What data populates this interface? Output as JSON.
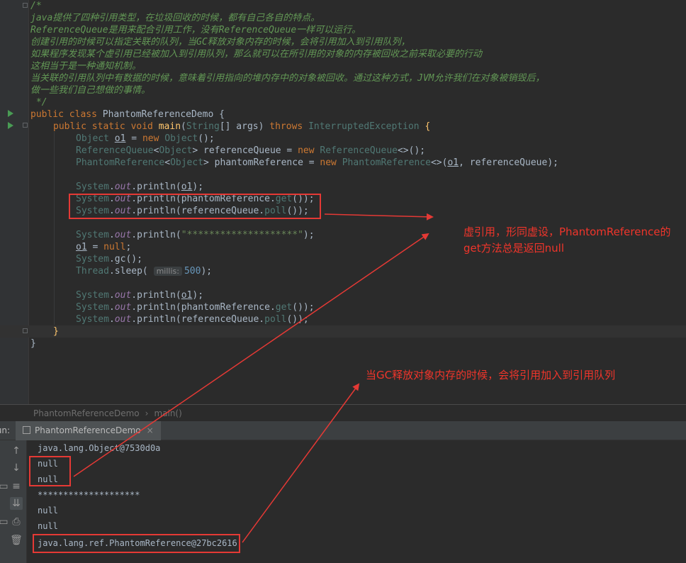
{
  "editor": {
    "comment_lines": [
      "/*",
      "java提供了四种引用类型，在垃圾回收的时候，都有自己各自的特点。",
      "ReferenceQueue是用来配合引用工作，没有ReferenceQueue一样可以运行。",
      "创建引用的时候可以指定关联的队列，当GC释放对象内存的时候，会将引用加入到引用队列，",
      "如果程序发现某个虚引用已经被加入到引用队列，那么就可以在所引用的对象的内存被回收之前采取必要的行动",
      "这相当于是一种通知机制。",
      "当关联的引用队列中有数据的时候，意味着引用指向的堆内存中的对象被回收。通过这种方式，JVM允许我们在对象被销毁后，",
      "做一些我们自己想做的事情。",
      " */"
    ],
    "class_name": "PhantomReferenceDemo",
    "method_name": "main",
    "exception_name": "InterruptedException",
    "hint_label": "millis:",
    "sleep_value": "500",
    "stars_string": "\"********************\""
  },
  "breadcrumb": {
    "items": [
      "PhantomReferenceDemo",
      "›",
      "main()"
    ]
  },
  "run_panel": {
    "label": "Run:",
    "tab_label": "PhantomReferenceDemo",
    "close_glyph": "×",
    "output_lines": [
      "java.lang.Object@7530d0a",
      "null",
      "null",
      "********************",
      "null",
      "null",
      "java.lang.ref.PhantomReference@27bc2616"
    ]
  },
  "annotations": {
    "note1_line1": "虚引用，形同虚设，PhantomReference的",
    "note1_line2": "get方法总是返回null",
    "note2": "当GC释放对象内存的时候，会将引用加入到引用队列",
    "color": "#f0352b"
  },
  "icons": [
    "run-gutter-icon",
    "rerun-up-icon",
    "down-icon",
    "wrap-icon",
    "scroll-end-icon",
    "print-icon",
    "trash-icon"
  ]
}
